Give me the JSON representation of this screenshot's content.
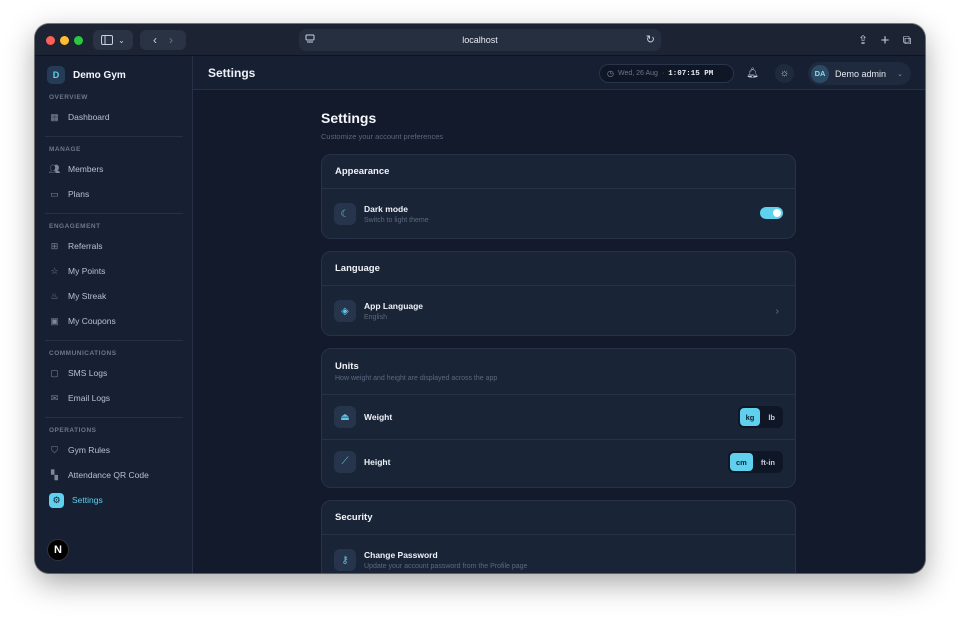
{
  "browser": {
    "url": "localhost"
  },
  "sidebar": {
    "brand_initial": "D",
    "brand_name": "Demo Gym",
    "sections": {
      "overview": "OVERVIEW",
      "manage": "MANAGE",
      "engagement": "ENGAGEMENT",
      "communications": "COMMUNICATIONS",
      "operations": "OPERATIONS"
    },
    "items": {
      "dashboard": "Dashboard",
      "members": "Members",
      "plans": "Plans",
      "referrals": "Referrals",
      "my_points": "My Points",
      "my_streak": "My Streak",
      "my_coupons": "My Coupons",
      "sms_logs": "SMS Logs",
      "email_logs": "Email Logs",
      "gym_rules": "Gym Rules",
      "attendance_qr": "Attendance QR Code",
      "settings": "Settings"
    },
    "badge": "N"
  },
  "header": {
    "title": "Settings",
    "date": "Wed, 26 Aug",
    "time": "1:07:15 PM",
    "user_initials": "DA",
    "user_name": "Demo admin"
  },
  "page": {
    "title": "Settings",
    "subtitle": "Customize your account preferences"
  },
  "appearance": {
    "title": "Appearance",
    "dark_mode_label": "Dark mode",
    "dark_mode_desc": "Switch to light theme",
    "dark_mode_on": true
  },
  "language": {
    "title": "Language",
    "label": "App Language",
    "value": "English"
  },
  "units": {
    "title": "Units",
    "desc": "How weight and height are displayed across the app",
    "weight_label": "Weight",
    "weight_options": [
      "kg",
      "lb"
    ],
    "weight_selected": "kg",
    "height_label": "Height",
    "height_options": [
      "cm",
      "ft-in"
    ],
    "height_selected": "cm"
  },
  "security": {
    "title": "Security",
    "change_password_label": "Change Password",
    "change_password_desc": "Update your account password from the Profile page"
  },
  "colors": {
    "accent": "#5fd0ee",
    "background": "#121a2b",
    "card": "#1a2437"
  }
}
